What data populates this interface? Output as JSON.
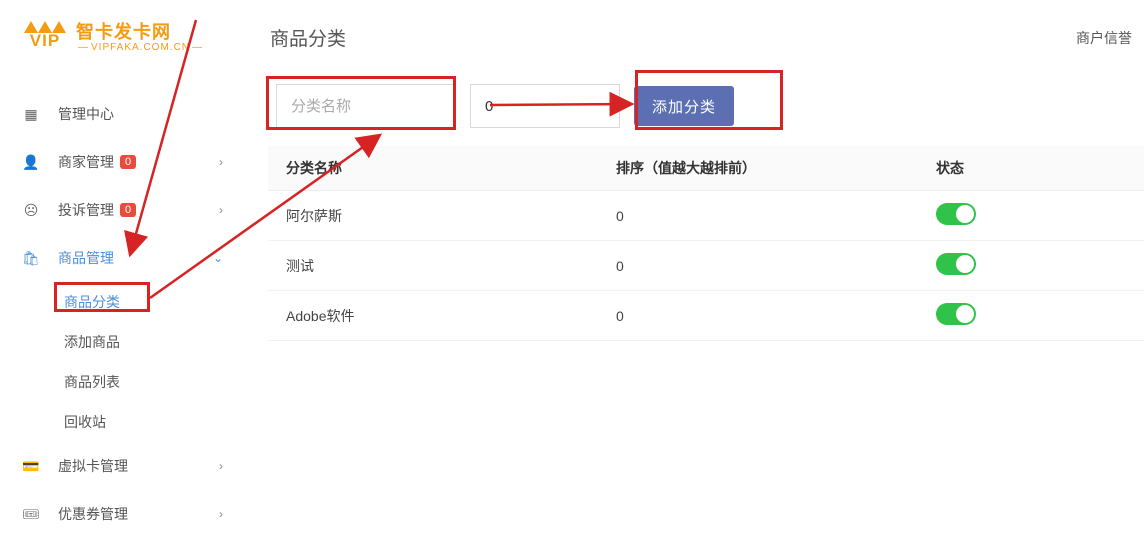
{
  "brand": {
    "zh": "智卡发卡网",
    "en": "VIPFAKA.COM.CN",
    "vip": "VIP"
  },
  "header": {
    "page_title": "商品分类",
    "right_link": "商户信誉"
  },
  "sidebar": {
    "items": [
      {
        "label": "管理中心",
        "badge": null,
        "expandable": false
      },
      {
        "label": "商家管理",
        "badge": "0",
        "expandable": true
      },
      {
        "label": "投诉管理",
        "badge": "0",
        "expandable": true
      },
      {
        "label": "商品管理",
        "badge": null,
        "expandable": true,
        "active": true,
        "children": [
          {
            "label": "商品分类",
            "active": true
          },
          {
            "label": "添加商品"
          },
          {
            "label": "商品列表"
          },
          {
            "label": "回收站"
          }
        ]
      },
      {
        "label": "虚拟卡管理",
        "badge": null,
        "expandable": true
      },
      {
        "label": "优惠券管理",
        "badge": null,
        "expandable": true
      }
    ]
  },
  "form": {
    "name_placeholder": "分类名称",
    "sort_value": "0",
    "submit_label": "添加分类"
  },
  "table": {
    "headers": {
      "name": "分类名称",
      "sort": "排序（值越大越排前）",
      "status": "状态"
    },
    "rows": [
      {
        "name": "阿尔萨斯",
        "sort": "0",
        "status_on": true
      },
      {
        "name": "测试",
        "sort": "0",
        "status_on": true
      },
      {
        "name": "Adobe软件",
        "sort": "0",
        "status_on": true
      }
    ]
  }
}
